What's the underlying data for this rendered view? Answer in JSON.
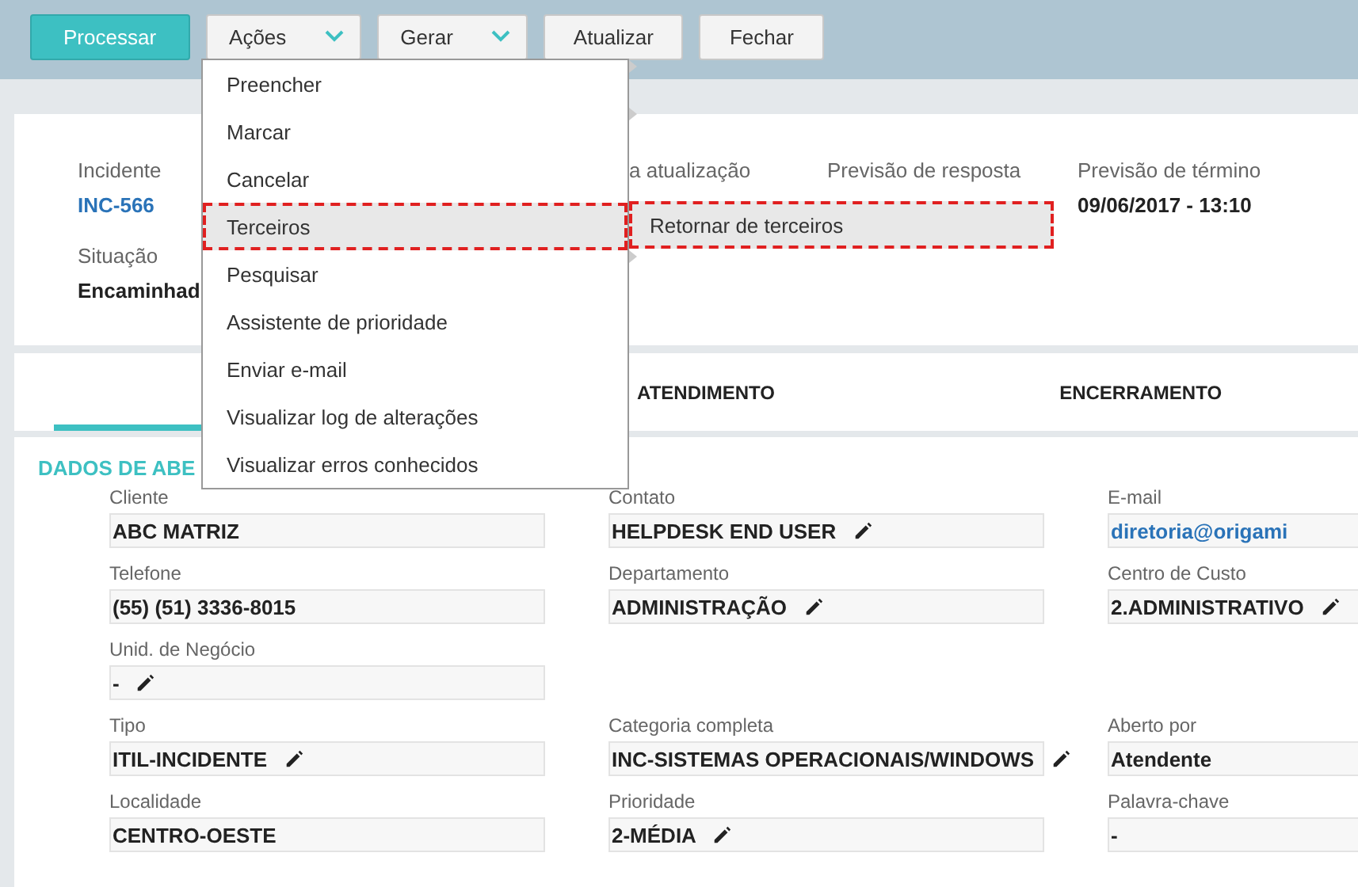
{
  "toolbar": [
    {
      "label": "Processar",
      "kind": "primary",
      "dropdown": false
    },
    {
      "label": "Ações",
      "kind": "default",
      "dropdown": true
    },
    {
      "label": "Gerar",
      "kind": "default",
      "dropdown": true
    },
    {
      "label": "Atualizar",
      "kind": "default",
      "dropdown": false
    },
    {
      "label": "Fechar",
      "kind": "default",
      "dropdown": false
    }
  ],
  "menu": {
    "items": [
      {
        "label": "Preencher",
        "selected": false,
        "submenu": true
      },
      {
        "label": "Marcar",
        "selected": false,
        "submenu": true
      },
      {
        "label": "Cancelar",
        "selected": false,
        "submenu": false
      },
      {
        "label": "Terceiros",
        "selected": true,
        "submenu": true
      },
      {
        "label": "Pesquisar",
        "selected": false,
        "submenu": true
      },
      {
        "label": "Assistente de prioridade",
        "selected": false,
        "submenu": false
      },
      {
        "label": "Enviar e-mail",
        "selected": false,
        "submenu": false
      },
      {
        "label": "Visualizar log de alterações",
        "selected": false,
        "submenu": false
      },
      {
        "label": "Visualizar erros conhecidos",
        "selected": false,
        "submenu": false
      }
    ],
    "submenu": [
      {
        "label": "Retornar de terceiros",
        "selected": true
      }
    ]
  },
  "header": [
    {
      "label": "Incidente",
      "value": "INC-566",
      "kind": "link"
    },
    {
      "label": "a atualização"
    },
    {
      "label": "Previsão de resposta"
    },
    {
      "label": "Previsão de término",
      "value": "09/06/2017 - 13:10",
      "kind": "text"
    },
    {
      "label": "Situação",
      "value": "Encaminhad",
      "kind": "text"
    }
  ],
  "tabs": [
    {
      "selected": true
    },
    {
      "label": "ATENDIMENTO",
      "selected": false
    },
    {
      "label": "ENCERRAMENTO",
      "selected": false
    }
  ],
  "section": {
    "title": "DADOS DE ABE",
    "rows": [
      [
        {
          "label": "Cliente",
          "value": "ABC MATRIZ",
          "kind": "text",
          "editable": false
        },
        {
          "label": "Contato",
          "value": "HELPDESK END USER",
          "kind": "text",
          "editable": true
        },
        {
          "label": "E-mail",
          "value": "diretoria@origami",
          "kind": "link",
          "editable": false
        }
      ],
      [
        {
          "label": "Telefone",
          "value": "(55) (51) 3336-8015",
          "kind": "text",
          "editable": false
        },
        {
          "label": "Departamento",
          "value": "ADMINISTRAÇÃO",
          "kind": "text",
          "editable": true
        },
        {
          "label": "Centro de Custo",
          "value": "2.ADMINISTRATIVO",
          "kind": "text",
          "editable": true
        }
      ],
      [
        {
          "label": "Unid. de Negócio",
          "value": "-",
          "kind": "text",
          "editable": true
        }
      ],
      [
        {
          "label": "Tipo",
          "value": "ITIL-INCIDENTE",
          "kind": "text",
          "editable": true
        },
        {
          "label": "Categoria completa",
          "value": "INC-SISTEMAS OPERACIONAIS/WINDOWS",
          "kind": "text",
          "editable": true
        },
        {
          "label": "Aberto por",
          "value": "Atendente",
          "kind": "text",
          "editable": false
        }
      ],
      [
        {
          "label": "Localidade",
          "value": "CENTRO-OESTE",
          "kind": "text",
          "editable": false
        },
        {
          "label": "Prioridade",
          "value": "2-MÉDIA",
          "kind": "text",
          "editable": true
        },
        {
          "label": "Palavra-chave",
          "value": "-",
          "kind": "text",
          "editable": false
        }
      ]
    ]
  }
}
